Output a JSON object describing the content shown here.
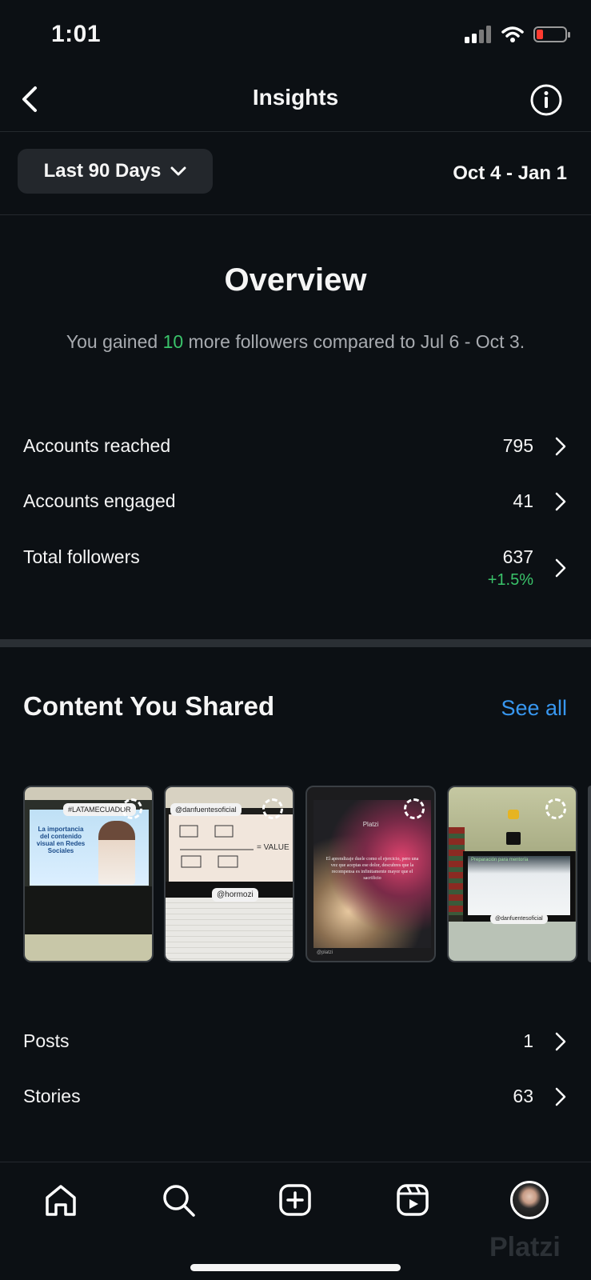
{
  "status_bar": {
    "time": "1:01"
  },
  "header": {
    "title": "Insights"
  },
  "range": {
    "selected": "Last 90 Days",
    "dates": "Oct 4 - Jan 1"
  },
  "overview": {
    "title": "Overview",
    "text_before": "You gained ",
    "gained_count": "10",
    "text_after": " more followers compared to Jul 6 - Oct 3."
  },
  "metrics": [
    {
      "label": "Accounts reached",
      "value": "795"
    },
    {
      "label": "Accounts engaged",
      "value": "41"
    },
    {
      "label": "Total followers",
      "value": "637",
      "change": "+1.5%"
    }
  ],
  "content": {
    "title": "Content You Shared",
    "see_all": "See all",
    "thumbnails": [
      {
        "tag": "#LATAMECUADOR",
        "heading": "La importancia del contenido visual en Redes Sociales"
      },
      {
        "tag": "@danfuentesoficial",
        "tag2": "@hormozi",
        "heading": "= VALUE"
      },
      {
        "brand": "Platzi",
        "quote": "El aprendizaje duele como el ejercicio, pero una vez que aceptas ese dolor, descubres que la recompensa es infinitamente mayor que el sacrificio",
        "footer": "@platzi"
      },
      {
        "tag": "@danfuentesoficial",
        "heading": "Preparación para mentoría"
      }
    ],
    "rows": [
      {
        "label": "Posts",
        "value": "1"
      },
      {
        "label": "Stories",
        "value": "63"
      }
    ]
  },
  "watermark": "Platzi",
  "colors": {
    "background": "#0c1014",
    "accent_green": "#3ac36a",
    "link_blue": "#3897f0"
  }
}
